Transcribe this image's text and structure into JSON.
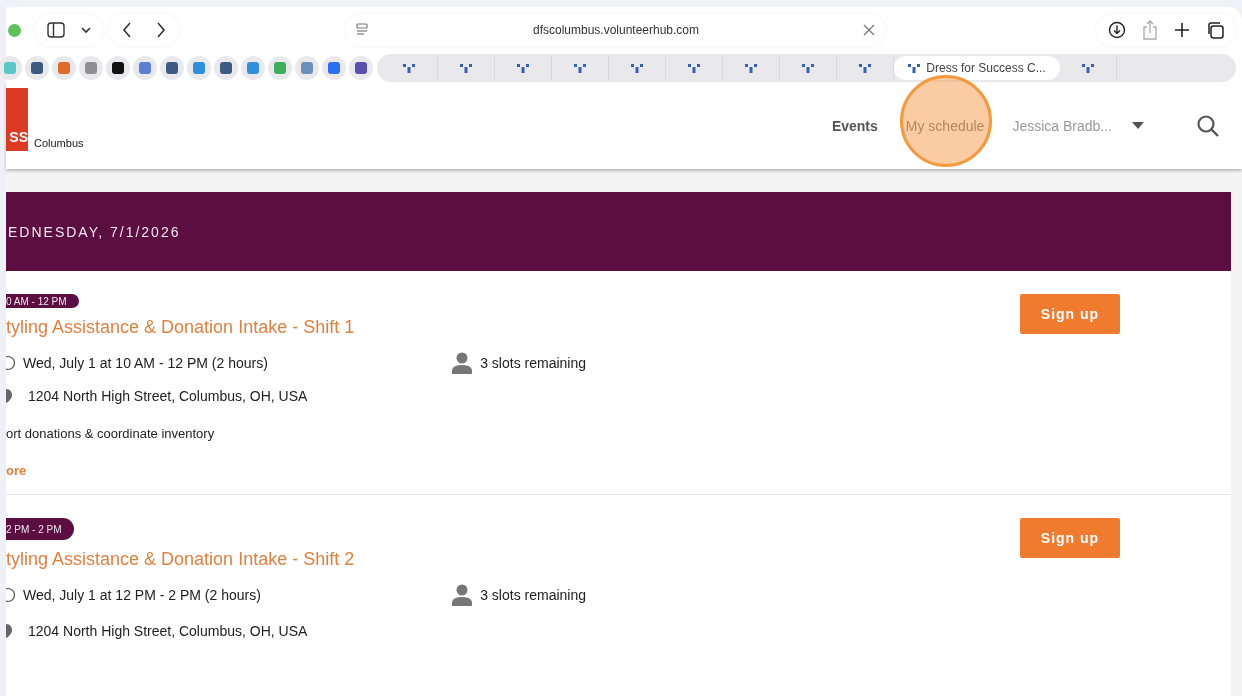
{
  "browser": {
    "address": "dfscolumbus.volunteerhub.com",
    "tabs": [
      {
        "selected": false
      },
      {
        "selected": false
      },
      {
        "selected": false
      },
      {
        "selected": false
      },
      {
        "selected": false
      },
      {
        "selected": false
      },
      {
        "selected": false
      },
      {
        "selected": false
      },
      {
        "selected": false
      },
      {
        "title": "Dress for Success C...",
        "selected": true
      },
      {
        "selected": false
      }
    ]
  },
  "header": {
    "logo_text": "SS",
    "org": "Columbus",
    "nav": [
      {
        "label": "Events",
        "selected": true
      },
      {
        "label": "My schedule",
        "selected": false,
        "highlighted": true
      }
    ],
    "user": "Jessica Bradb..."
  },
  "day": "EDNESDAY, 7/1/2026",
  "events": [
    {
      "time": "0 AM - 12 PM",
      "title": "tyling Assistance & Donation Intake - Shift 1",
      "when": "Wed, July 1 at 10 AM - 12 PM (2 hours)",
      "slots": "3 slots remaining",
      "location": "1204 North High Street, Columbus, OH, USA",
      "description": "ort donations & coordinate inventory",
      "more": "ore",
      "button": "Sign up"
    },
    {
      "time": "2 PM - 2 PM",
      "title": "tyling Assistance & Donation Intake - Shift 2",
      "when": "Wed, July 1 at 12 PM - 2 PM (2 hours)",
      "slots": "3 slots remaining",
      "location": "1204 North High Street, Columbus, OH, USA",
      "button": "Sign up"
    }
  ]
}
